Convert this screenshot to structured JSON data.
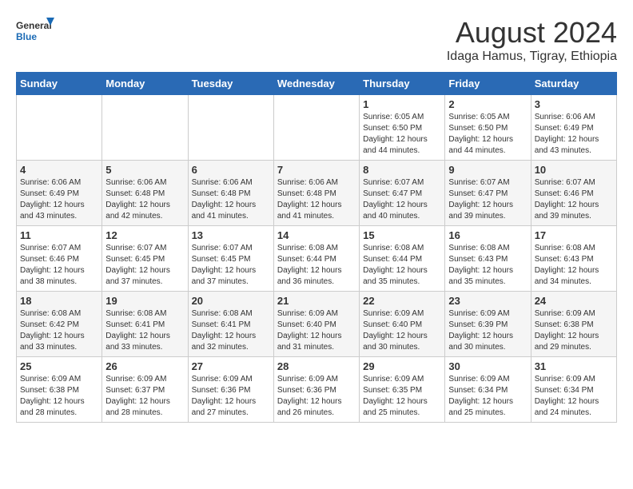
{
  "header": {
    "logo": {
      "general": "General",
      "blue": "Blue"
    },
    "title": "August 2024",
    "subtitle": "Idaga Hamus, Tigray, Ethiopia"
  },
  "days_of_week": [
    "Sunday",
    "Monday",
    "Tuesday",
    "Wednesday",
    "Thursday",
    "Friday",
    "Saturday"
  ],
  "weeks": [
    [
      {
        "day": "",
        "info": ""
      },
      {
        "day": "",
        "info": ""
      },
      {
        "day": "",
        "info": ""
      },
      {
        "day": "",
        "info": ""
      },
      {
        "day": "1",
        "info": "Sunrise: 6:05 AM\nSunset: 6:50 PM\nDaylight: 12 hours\nand 44 minutes."
      },
      {
        "day": "2",
        "info": "Sunrise: 6:05 AM\nSunset: 6:50 PM\nDaylight: 12 hours\nand 44 minutes."
      },
      {
        "day": "3",
        "info": "Sunrise: 6:06 AM\nSunset: 6:49 PM\nDaylight: 12 hours\nand 43 minutes."
      }
    ],
    [
      {
        "day": "4",
        "info": "Sunrise: 6:06 AM\nSunset: 6:49 PM\nDaylight: 12 hours\nand 43 minutes."
      },
      {
        "day": "5",
        "info": "Sunrise: 6:06 AM\nSunset: 6:48 PM\nDaylight: 12 hours\nand 42 minutes."
      },
      {
        "day": "6",
        "info": "Sunrise: 6:06 AM\nSunset: 6:48 PM\nDaylight: 12 hours\nand 41 minutes."
      },
      {
        "day": "7",
        "info": "Sunrise: 6:06 AM\nSunset: 6:48 PM\nDaylight: 12 hours\nand 41 minutes."
      },
      {
        "day": "8",
        "info": "Sunrise: 6:07 AM\nSunset: 6:47 PM\nDaylight: 12 hours\nand 40 minutes."
      },
      {
        "day": "9",
        "info": "Sunrise: 6:07 AM\nSunset: 6:47 PM\nDaylight: 12 hours\nand 39 minutes."
      },
      {
        "day": "10",
        "info": "Sunrise: 6:07 AM\nSunset: 6:46 PM\nDaylight: 12 hours\nand 39 minutes."
      }
    ],
    [
      {
        "day": "11",
        "info": "Sunrise: 6:07 AM\nSunset: 6:46 PM\nDaylight: 12 hours\nand 38 minutes."
      },
      {
        "day": "12",
        "info": "Sunrise: 6:07 AM\nSunset: 6:45 PM\nDaylight: 12 hours\nand 37 minutes."
      },
      {
        "day": "13",
        "info": "Sunrise: 6:07 AM\nSunset: 6:45 PM\nDaylight: 12 hours\nand 37 minutes."
      },
      {
        "day": "14",
        "info": "Sunrise: 6:08 AM\nSunset: 6:44 PM\nDaylight: 12 hours\nand 36 minutes."
      },
      {
        "day": "15",
        "info": "Sunrise: 6:08 AM\nSunset: 6:44 PM\nDaylight: 12 hours\nand 35 minutes."
      },
      {
        "day": "16",
        "info": "Sunrise: 6:08 AM\nSunset: 6:43 PM\nDaylight: 12 hours\nand 35 minutes."
      },
      {
        "day": "17",
        "info": "Sunrise: 6:08 AM\nSunset: 6:43 PM\nDaylight: 12 hours\nand 34 minutes."
      }
    ],
    [
      {
        "day": "18",
        "info": "Sunrise: 6:08 AM\nSunset: 6:42 PM\nDaylight: 12 hours\nand 33 minutes."
      },
      {
        "day": "19",
        "info": "Sunrise: 6:08 AM\nSunset: 6:41 PM\nDaylight: 12 hours\nand 33 minutes."
      },
      {
        "day": "20",
        "info": "Sunrise: 6:08 AM\nSunset: 6:41 PM\nDaylight: 12 hours\nand 32 minutes."
      },
      {
        "day": "21",
        "info": "Sunrise: 6:09 AM\nSunset: 6:40 PM\nDaylight: 12 hours\nand 31 minutes."
      },
      {
        "day": "22",
        "info": "Sunrise: 6:09 AM\nSunset: 6:40 PM\nDaylight: 12 hours\nand 30 minutes."
      },
      {
        "day": "23",
        "info": "Sunrise: 6:09 AM\nSunset: 6:39 PM\nDaylight: 12 hours\nand 30 minutes."
      },
      {
        "day": "24",
        "info": "Sunrise: 6:09 AM\nSunset: 6:38 PM\nDaylight: 12 hours\nand 29 minutes."
      }
    ],
    [
      {
        "day": "25",
        "info": "Sunrise: 6:09 AM\nSunset: 6:38 PM\nDaylight: 12 hours\nand 28 minutes."
      },
      {
        "day": "26",
        "info": "Sunrise: 6:09 AM\nSunset: 6:37 PM\nDaylight: 12 hours\nand 28 minutes."
      },
      {
        "day": "27",
        "info": "Sunrise: 6:09 AM\nSunset: 6:36 PM\nDaylight: 12 hours\nand 27 minutes."
      },
      {
        "day": "28",
        "info": "Sunrise: 6:09 AM\nSunset: 6:36 PM\nDaylight: 12 hours\nand 26 minutes."
      },
      {
        "day": "29",
        "info": "Sunrise: 6:09 AM\nSunset: 6:35 PM\nDaylight: 12 hours\nand 25 minutes."
      },
      {
        "day": "30",
        "info": "Sunrise: 6:09 AM\nSunset: 6:34 PM\nDaylight: 12 hours\nand 25 minutes."
      },
      {
        "day": "31",
        "info": "Sunrise: 6:09 AM\nSunset: 6:34 PM\nDaylight: 12 hours\nand 24 minutes."
      }
    ]
  ]
}
